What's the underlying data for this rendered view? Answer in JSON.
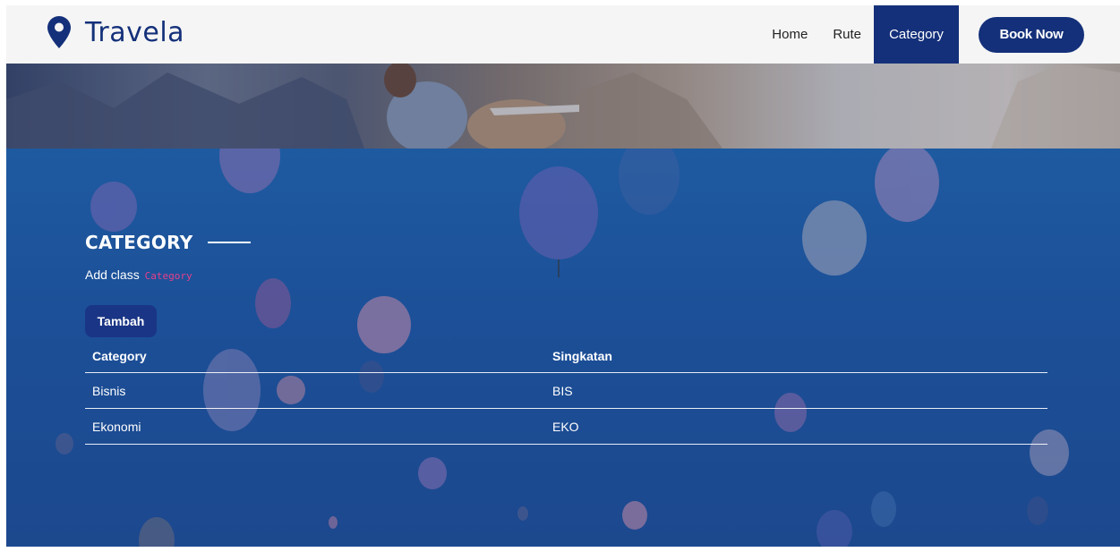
{
  "brand": {
    "name": "Travela",
    "icon": "map-pin-icon"
  },
  "nav": {
    "items": [
      {
        "label": "Home",
        "active": false
      },
      {
        "label": "Rute",
        "active": false
      },
      {
        "label": "Category",
        "active": true
      }
    ],
    "cta": "Book Now"
  },
  "section": {
    "title": "CATEGORY",
    "subtitle": "Add class",
    "subtitle_code": "Category",
    "add_button": "Tambah"
  },
  "table": {
    "headers": [
      "Category",
      "Singkatan"
    ],
    "rows": [
      [
        "Bisnis",
        "BIS"
      ],
      [
        "Ekonomi",
        "EKO"
      ]
    ]
  },
  "colors": {
    "primary": "#14307a",
    "section_bg": "#1e5aa0",
    "code": "#e83e8c"
  }
}
